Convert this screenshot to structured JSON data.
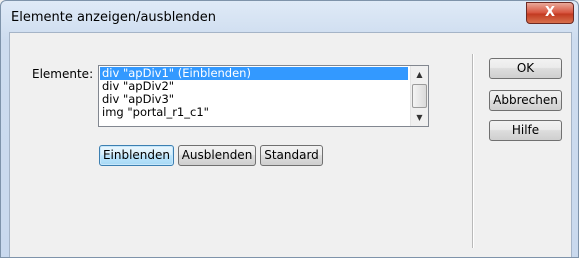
{
  "window": {
    "title": "Elemente anzeigen/ausblenden",
    "close_label": "X"
  },
  "form": {
    "elements_label": "Elemente:"
  },
  "listbox": {
    "items": [
      {
        "label": "div \"apDiv1\" (Einblenden)",
        "selected": true
      },
      {
        "label": "div \"apDiv2\"",
        "selected": false
      },
      {
        "label": "div \"apDiv3\"",
        "selected": false
      },
      {
        "label": "img \"portal_r1_c1\"",
        "selected": false
      }
    ],
    "scroll_up_icon": "▲",
    "scroll_down_icon": "▼"
  },
  "actions": {
    "show_label": "Einblenden",
    "hide_label": "Ausblenden",
    "default_label": "Standard"
  },
  "dialog_buttons": {
    "ok_label": "OK",
    "cancel_label": "Abbrechen",
    "help_label": "Hilfe"
  }
}
